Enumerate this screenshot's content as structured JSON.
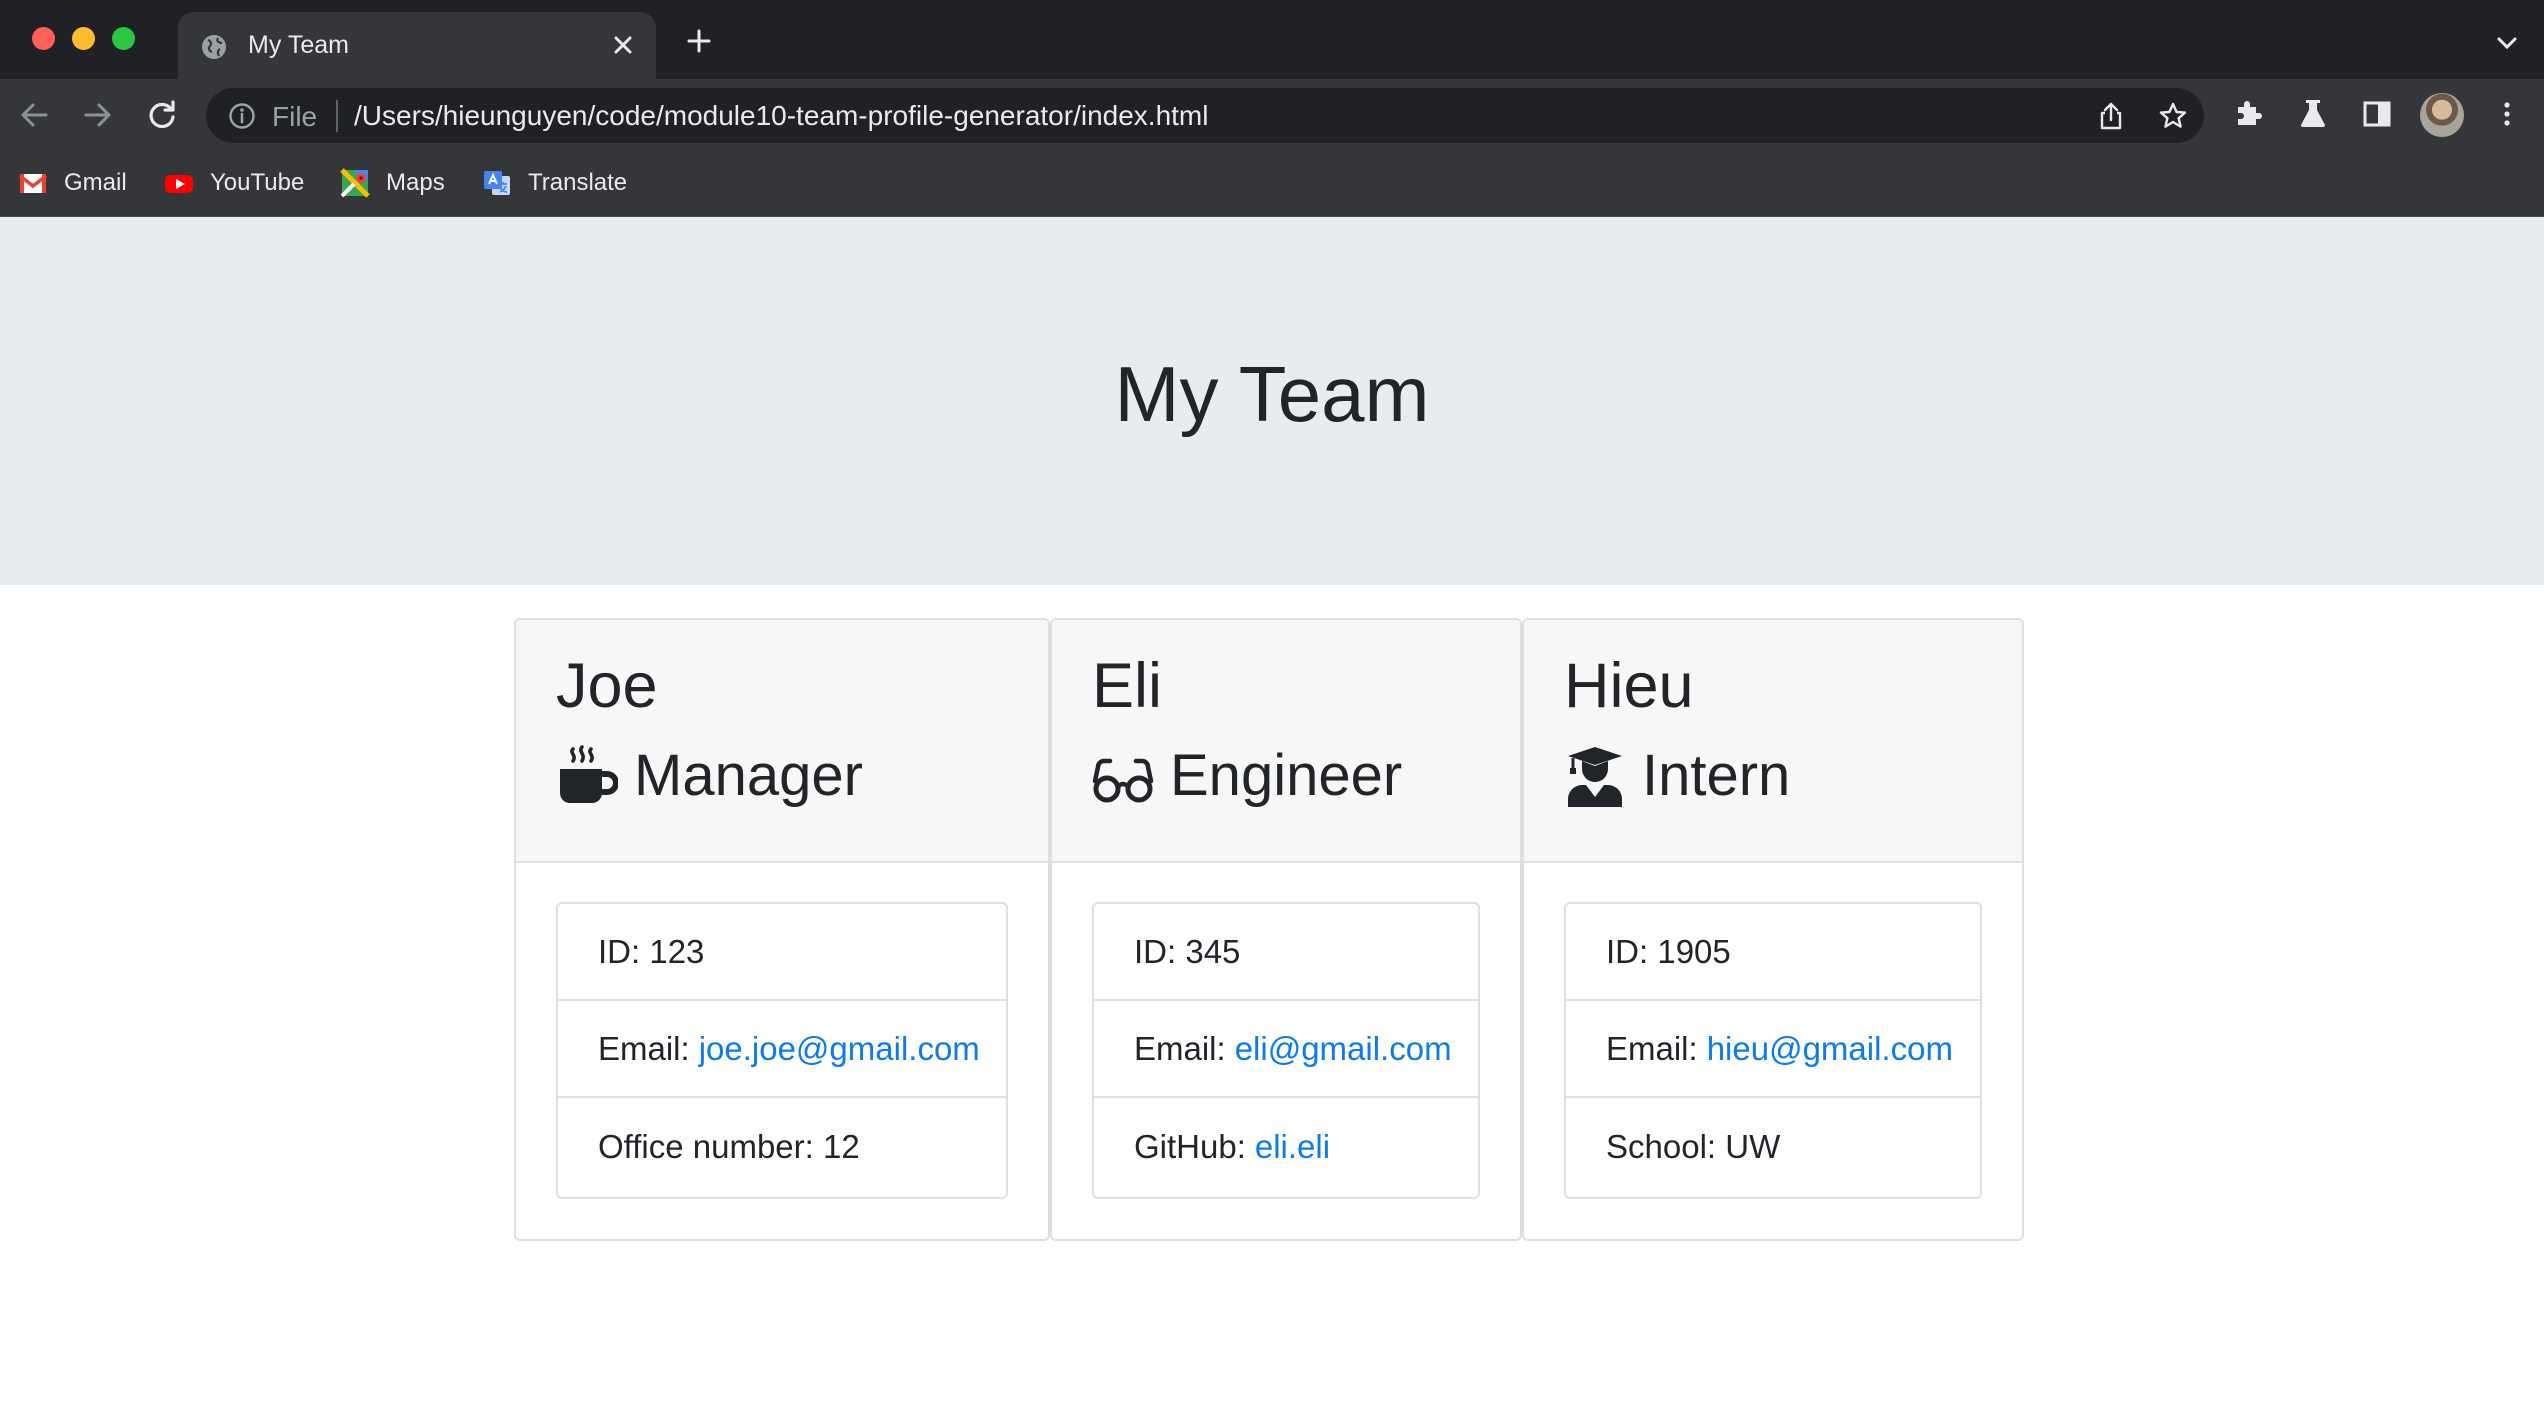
{
  "browser": {
    "tab": {
      "title": "My Team"
    },
    "address": {
      "scheme_label": "File",
      "url": "/Users/hieunguyen/code/module10-team-profile-generator/index.html"
    },
    "bookmarks": [
      {
        "label": "Gmail",
        "icon": "gmail-icon"
      },
      {
        "label": "YouTube",
        "icon": "youtube-icon"
      },
      {
        "label": "Maps",
        "icon": "maps-icon"
      },
      {
        "label": "Translate",
        "icon": "translate-icon"
      }
    ]
  },
  "page": {
    "title": "My Team",
    "team": [
      {
        "name": "Joe",
        "role": "Manager",
        "role_icon": "mug-hot-icon",
        "id_text": "ID: 123",
        "email_label": "Email:",
        "email": "joe.joe@gmail.com",
        "extra_text": "Office number: 12"
      },
      {
        "name": "Eli",
        "role": "Engineer",
        "role_icon": "glasses-icon",
        "id_text": "ID: 345",
        "email_label": "Email:",
        "email": "eli@gmail.com",
        "extra_label": "GitHub:",
        "extra_link": "eli.eli"
      },
      {
        "name": "Hieu",
        "role": "Intern",
        "role_icon": "user-graduate-icon",
        "id_text": "ID: 1905",
        "email_label": "Email:",
        "email": "hieu@gmail.com",
        "extra_text": "School: UW"
      }
    ]
  },
  "colors": {
    "jumbotron": "#e9ecef",
    "card_header": "#f7f7f7",
    "link": "#0d7bf0",
    "text": "#212529"
  }
}
